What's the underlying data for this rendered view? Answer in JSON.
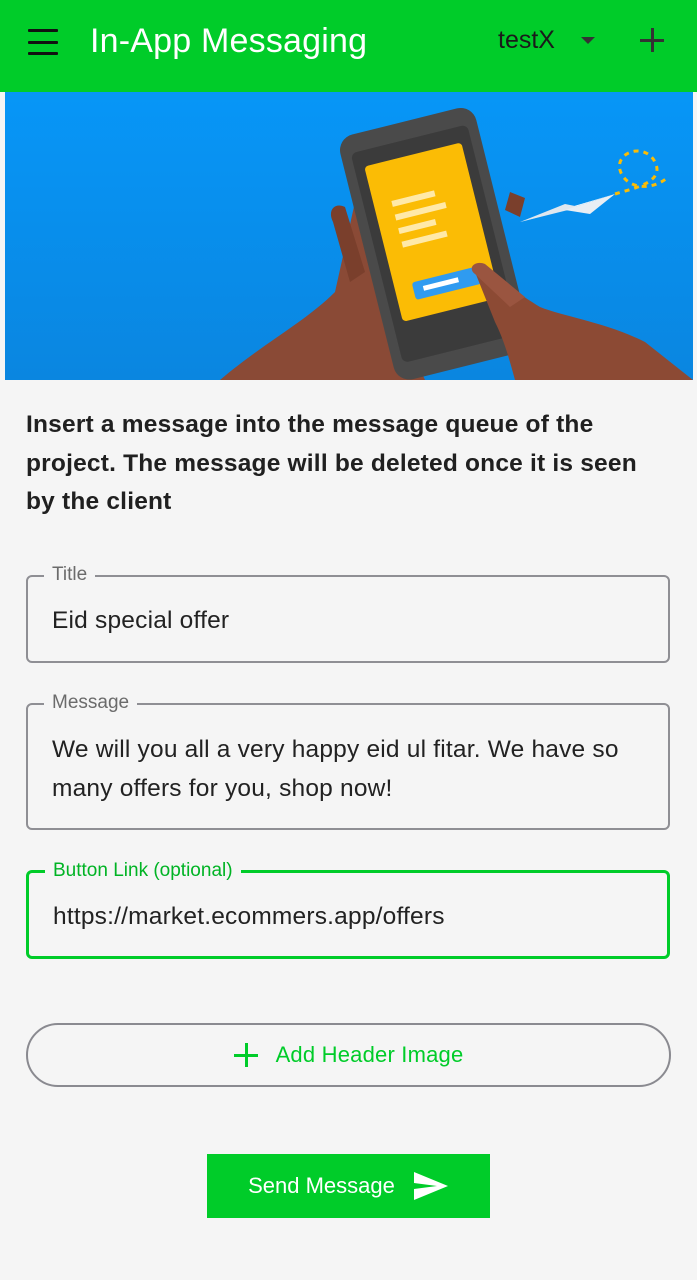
{
  "app": {
    "title": "In-App Messaging",
    "project": "testX",
    "accent": "#00cc29"
  },
  "hero": {
    "background": "#0a8ff0",
    "icons": [
      "phone-illustration",
      "paper-plane-icon"
    ]
  },
  "intro": {
    "text": "Insert a message into the message queue of the project. The message will be deleted once it is seen by the client"
  },
  "form": {
    "title": {
      "label": "Title",
      "value": "Eid special offer"
    },
    "message": {
      "label": "Message",
      "value": "We will you all a very happy eid ul fitar. We have so many offers for you, shop now!"
    },
    "button_link": {
      "label": "Button Link (optional)",
      "value": "https://market.ecommers.app/offers"
    }
  },
  "actions": {
    "add_header_image": "Add Header Image",
    "send_message": "Send Message"
  }
}
